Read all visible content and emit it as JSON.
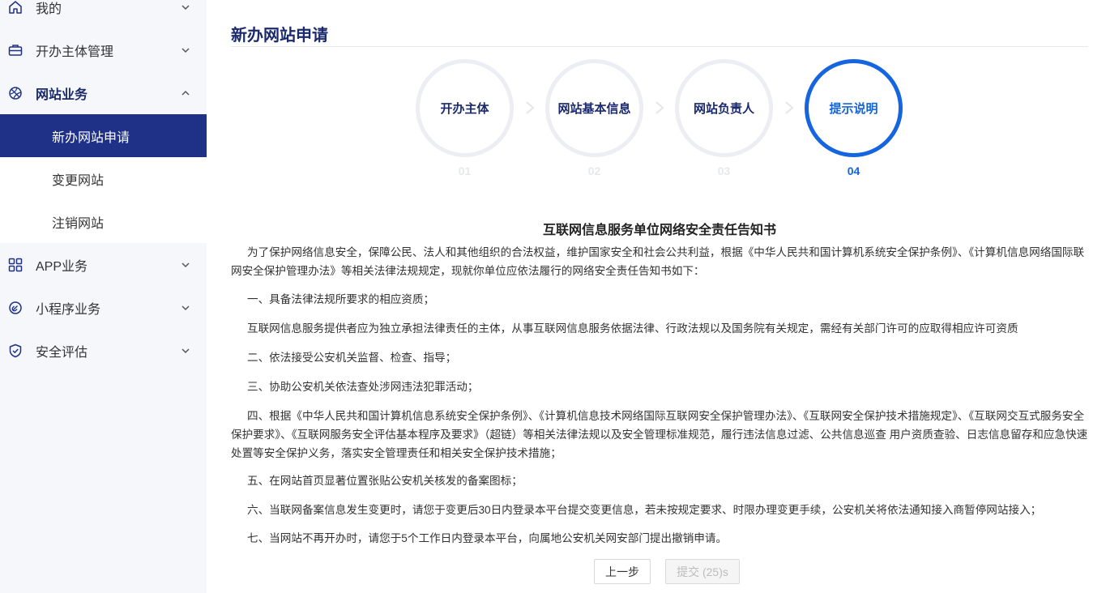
{
  "sidebar": {
    "items": [
      {
        "label": "我的",
        "icon": "home-icon"
      },
      {
        "label": "开办主体管理",
        "icon": "briefcase-icon"
      },
      {
        "label": "网站业务",
        "icon": "globe-icon"
      },
      {
        "label": "APP业务",
        "icon": "grid-icon"
      },
      {
        "label": "小程序业务",
        "icon": "link-icon"
      },
      {
        "label": "安全评估",
        "icon": "shield-icon"
      }
    ],
    "sub_items": [
      {
        "label": "新办网站申请",
        "active": true
      },
      {
        "label": "变更网站"
      },
      {
        "label": "注销网站"
      }
    ]
  },
  "main": {
    "title": "新办网站申请",
    "steps": [
      {
        "label": "开办主体",
        "num": "01"
      },
      {
        "label": "网站基本信息",
        "num": "02"
      },
      {
        "label": "网站负责人",
        "num": "03"
      },
      {
        "label": "提示说明",
        "num": "04",
        "active": true
      }
    ],
    "doc_title": "互联网信息服务单位网络安全责任告知书",
    "paragraphs": [
      "为了保护网络信息安全，保障公民、法人和其他组织的合法权益，维护国家安全和社会公共利益，根据《中华人民共和国计算机系统安全保护条例》、《计算机信息网络国际联网安全保护管理办法》等相关法律法规规定，现就你单位应依法履行的网络安全责任告知书如下：",
      "一、具备法律法规所要求的相应资质；",
      "互联网信息服务提供者应为独立承担法律责任的主体，从事互联网信息服务依据法律、行政法规以及国务院有关规定，需经有关部门许可的应取得相应许可资质",
      "二、依法接受公安机关监督、检查、指导；",
      "三、协助公安机关依法查处涉网违法犯罪活动；",
      "四、根据《中华人民共和国计算机信息系统安全保护条例》、《计算机信息技术网络国际互联网安全保护管理办法》、《互联网安全保护技术措施规定》、《互联网交互式服务安全保护要求》、《互联网服务安全评估基本程序及要求》（超链）等相关法律法规以及安全管理标准规范，履行违法信息过滤、公共信息巡查 用户资质查验、日志信息留存和应急快速处置等安全保护义务，落实安全管理责任和相关安全保护技术措施；",
      "五、在网站首页显著位置张贴公安机关核发的备案图标；",
      "六、当联网备案信息发生变更时，请您于变更后30日内登录本平台提交变更信息，若未按规定要求、时限办理变更手续，公安机关将依法通知接入商暂停网站接入；",
      "七、当网站不再开办时，请您于5个工作日内登录本平台，向属地公安机关网安部门提出撤销申请。"
    ],
    "buttons": {
      "prev": "上一步",
      "submit": "提交 (25)s"
    }
  },
  "colors": {
    "nav_active_bg": "#1e3186",
    "brand_text": "#1a2a6c",
    "step_active": "#1565e0",
    "step_inactive": "#eceef4"
  }
}
